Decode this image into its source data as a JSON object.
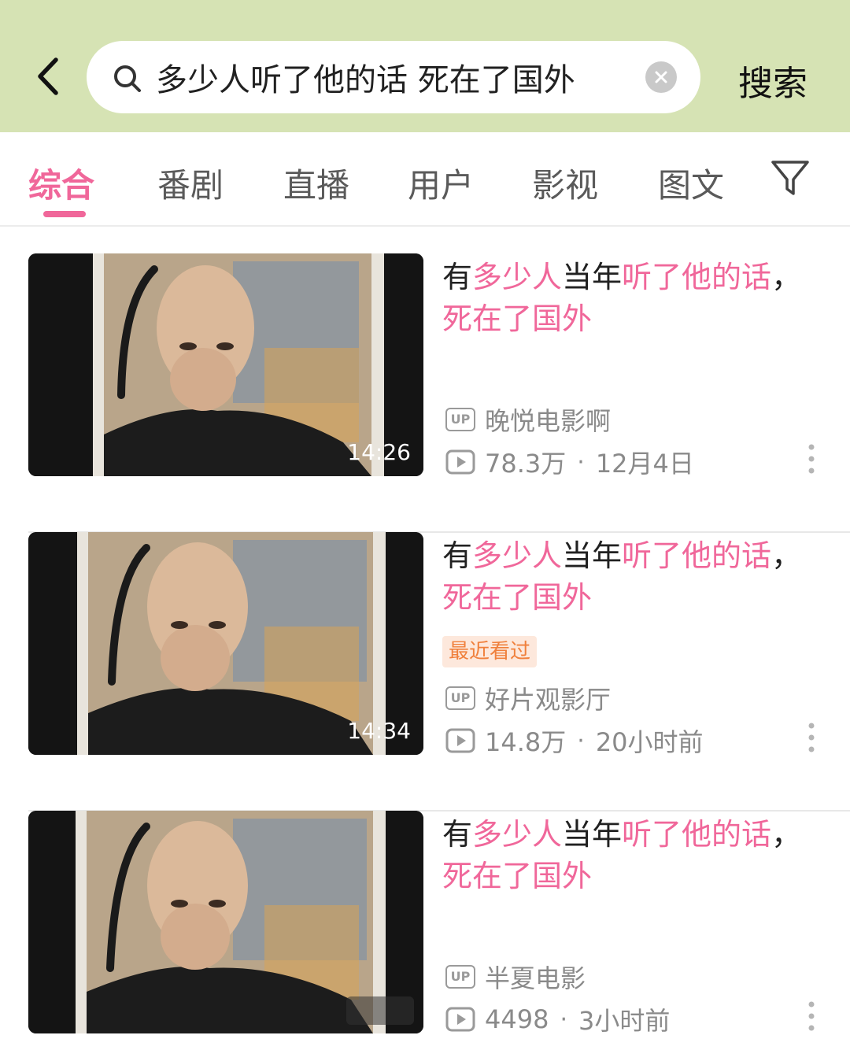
{
  "header": {
    "search_query": "多少人听了他的话 死在了国外",
    "search_button": "搜索",
    "bg_color": "#d6e3b4"
  },
  "tabs": [
    {
      "label": "综合",
      "active": true
    },
    {
      "label": "番剧",
      "active": false
    },
    {
      "label": "直播",
      "active": false
    },
    {
      "label": "用户",
      "active": false
    },
    {
      "label": "影视",
      "active": false
    },
    {
      "label": "图文",
      "active": false
    }
  ],
  "accent_color": "#f0679a",
  "results": [
    {
      "title_parts": [
        {
          "text": "有",
          "hl": false
        },
        {
          "text": "多少人",
          "hl": true
        },
        {
          "text": "当年",
          "hl": false
        },
        {
          "text": "听了他的话",
          "hl": true
        },
        {
          "text": "，",
          "hl": false
        },
        {
          "text": "死在了国外",
          "hl": true
        }
      ],
      "duration": "14:26",
      "badge": "",
      "uploader": "晚悦电影啊",
      "views": "78.3万",
      "date": "12月4日"
    },
    {
      "title_parts": [
        {
          "text": "有",
          "hl": false
        },
        {
          "text": "多少人",
          "hl": true
        },
        {
          "text": "当年",
          "hl": false
        },
        {
          "text": "听了他的话",
          "hl": true
        },
        {
          "text": "，",
          "hl": false
        },
        {
          "text": "死在了国外",
          "hl": true
        }
      ],
      "duration": "14:34",
      "badge": "最近看过",
      "uploader": "好片观影厅",
      "views": "14.8万",
      "date": "20小时前"
    },
    {
      "title_parts": [
        {
          "text": "有",
          "hl": false
        },
        {
          "text": "多少人",
          "hl": true
        },
        {
          "text": "当年",
          "hl": false
        },
        {
          "text": "听了他的话",
          "hl": true
        },
        {
          "text": "，",
          "hl": false
        },
        {
          "text": "死在了国外",
          "hl": true
        }
      ],
      "duration": "",
      "badge": "",
      "uploader": "半夏电影",
      "views": "4498",
      "date": "3小时前"
    }
  ],
  "up_label": "UP"
}
